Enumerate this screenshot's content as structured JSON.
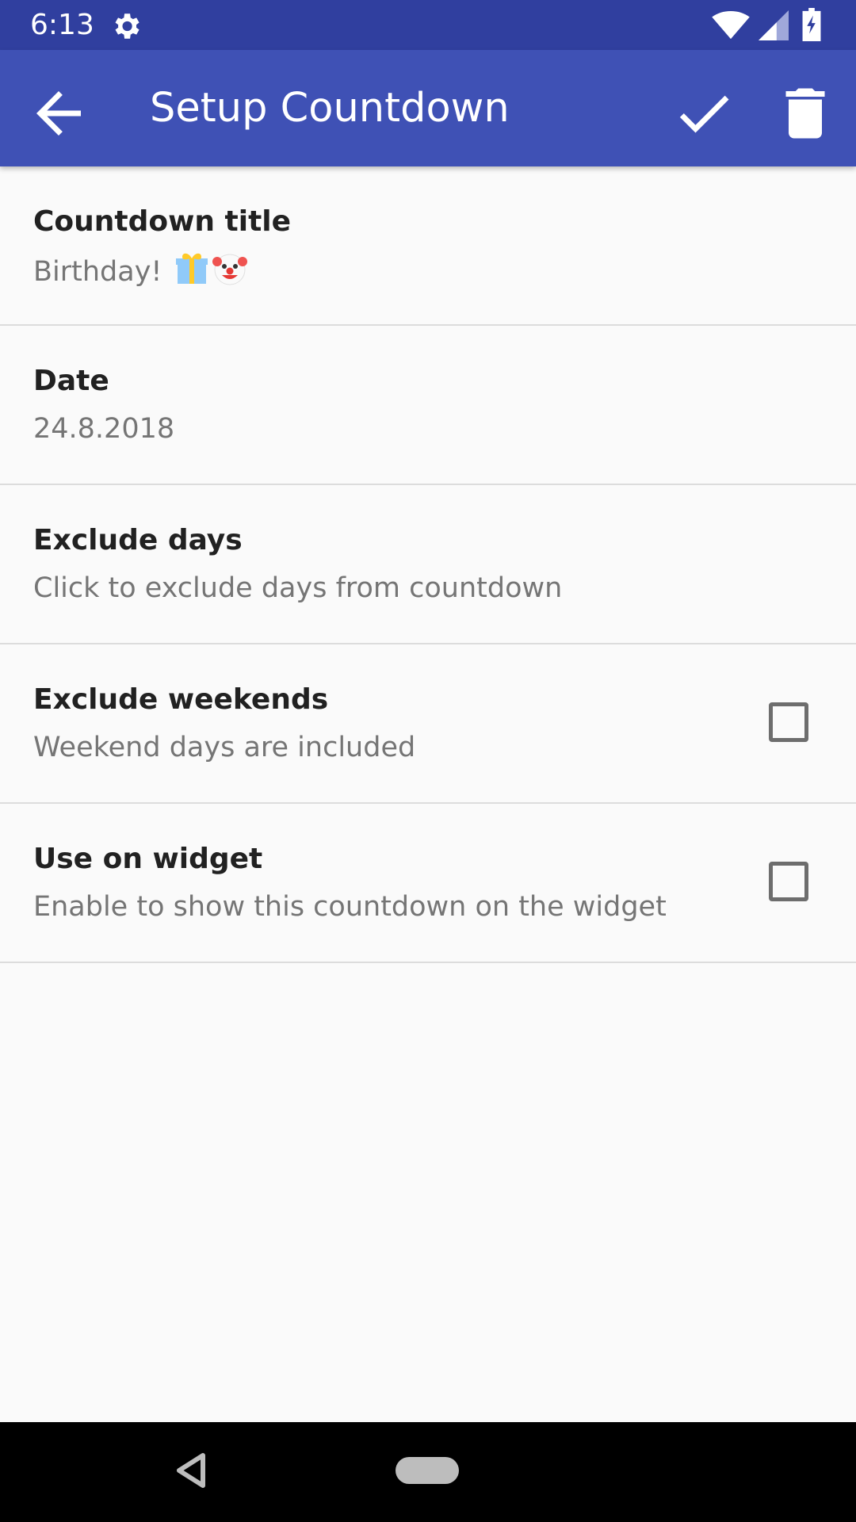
{
  "status_bar": {
    "time": "6:13",
    "icons": [
      "gear-icon",
      "wifi-icon",
      "signal-icon",
      "battery-charging-icon"
    ]
  },
  "app_bar": {
    "title": "Setup Countdown",
    "back_icon": "arrow-back-icon",
    "confirm_icon": "check-icon",
    "delete_icon": "trash-icon",
    "color": "#3f51b5",
    "status_color": "#303f9f"
  },
  "settings": [
    {
      "title": "Countdown title",
      "subtitle": "Birthday! ",
      "emojis": [
        "gift-emoji",
        "clown-emoji"
      ],
      "has_checkbox": false
    },
    {
      "title": "Date",
      "subtitle": "24.8.2018",
      "has_checkbox": false
    },
    {
      "title": "Exclude days",
      "subtitle": "Click to exclude days from countdown",
      "has_checkbox": false
    },
    {
      "title": "Exclude weekends",
      "subtitle": "Weekend days are included",
      "has_checkbox": true,
      "checked": false
    },
    {
      "title": "Use on widget",
      "subtitle": "Enable to show this countdown on the widget",
      "has_checkbox": true,
      "checked": false
    }
  ],
  "nav_bar": {
    "icons": [
      "nav-back-icon",
      "nav-home-pill"
    ]
  }
}
